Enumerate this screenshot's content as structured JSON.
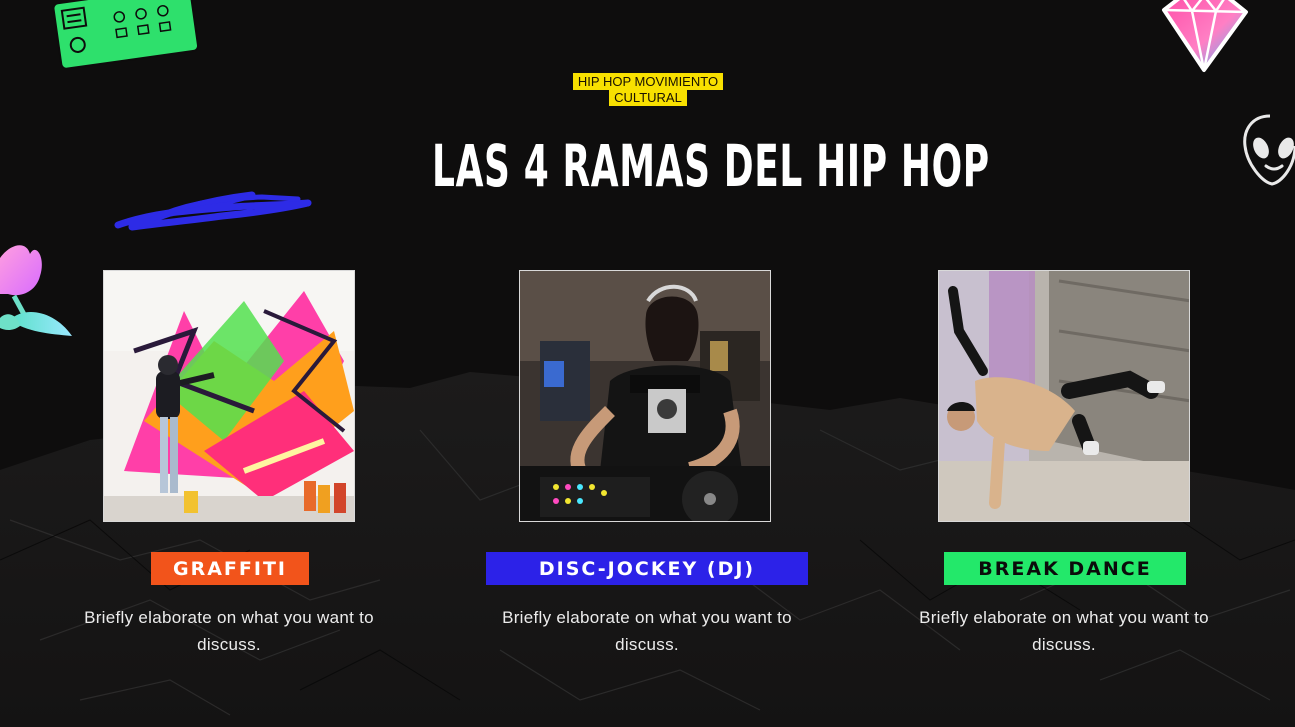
{
  "eyebrow": "HIP HOP MOVIMIENTO CULTURAL",
  "title": "LAS 4 RAMAS DEL HIP HOP",
  "cards": [
    {
      "label": "GRAFFITI",
      "description": "Briefly elaborate on what you want to discuss.",
      "label_bg": "#f2541b",
      "label_color": "#ffffff"
    },
    {
      "label": "DISC-JOCKEY (DJ)",
      "description": "Briefly elaborate on what you want to discuss.",
      "label_bg": "#2c22e8",
      "label_color": "#ffffff"
    },
    {
      "label": "BREAK DANCE",
      "description": "Briefly elaborate on what you want to discuss.",
      "label_bg": "#23e86a",
      "label_color": "#0b0b0b"
    }
  ],
  "stickers": [
    "cassette-sticker",
    "diamond-sticker",
    "alien-sticker",
    "tulip-sticker",
    "blue-scribble"
  ],
  "colors": {
    "background": "#0e0d0d",
    "eyebrow_bg": "#f8e000",
    "text": "#ffffff"
  }
}
